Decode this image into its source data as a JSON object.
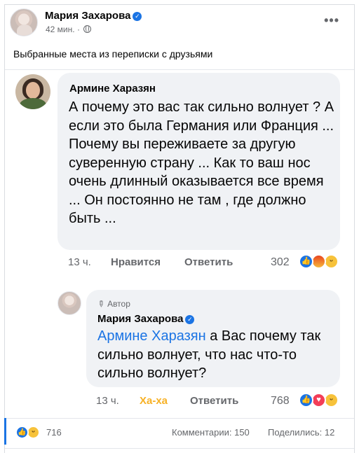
{
  "post": {
    "author": "Мария Захарова",
    "time": "42 мин.",
    "separator": "·",
    "caption": "Выбранные места из переписки с друзьями",
    "more": "•••"
  },
  "comments": [
    {
      "author": "Армине Харазян",
      "text": "А почему это вас так сильно волнует ? А если это была Германия или Франция ... Почему вы переживаете за другую суверенную страну ... Как то ваш нос очень длинный оказывается все время ... Он постоянно не там , где должно быть ...",
      "time": "13 ч.",
      "like_label": "Нравится",
      "reply_label": "Ответить",
      "reaction_count": "302"
    },
    {
      "badge": "Автор",
      "author": "Мария Захарова",
      "mention": "Армине Харазян",
      "text": " а Вас почему так сильно волнует, что нас что-то сильно волнует?",
      "time": "13 ч.",
      "like_label": "Ха-ха",
      "reply_label": "Ответить",
      "reaction_count": "768"
    }
  ],
  "footer": {
    "reaction_count": "716",
    "comments": "Комментарии: 150",
    "shares": "Поделились: 12"
  },
  "colors": {
    "accent": "#1b74e4",
    "haha": "#f7b125",
    "text_secondary": "#65676b"
  },
  "icons": [
    "globe-icon",
    "verified-icon",
    "like-icon",
    "angry-icon",
    "haha-icon",
    "love-icon",
    "pen-icon"
  ]
}
